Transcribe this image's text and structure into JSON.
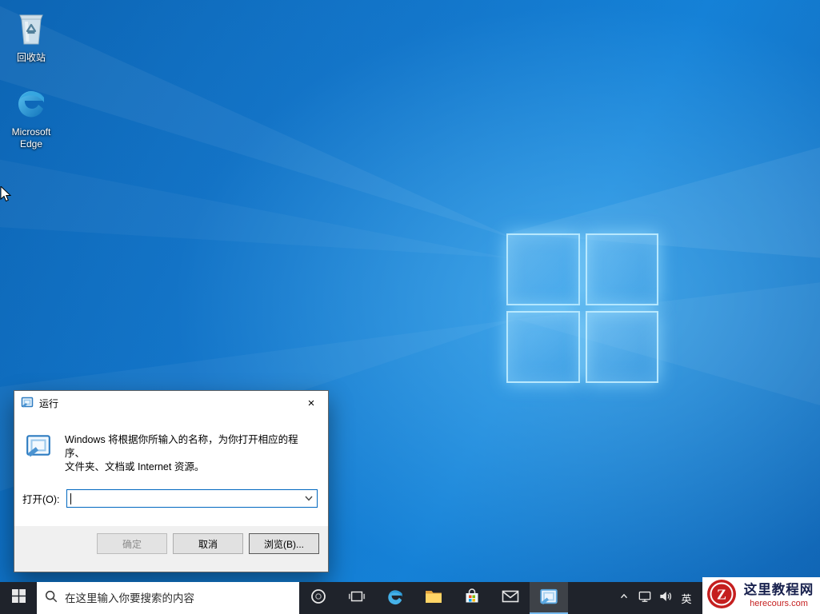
{
  "desktop": {
    "recycle_bin_label": "回收站",
    "edge_label": "Microsoft Edge"
  },
  "run_dialog": {
    "title": "运行",
    "close_label": "×",
    "description_line1": "Windows 将根据你所输入的名称，为你打开相应的程序、",
    "description_line2": "文件夹、文档或 Internet 资源。",
    "open_label": "打开(O):",
    "input_value": "",
    "ok_label": "确定",
    "cancel_label": "取消",
    "browse_label": "浏览(B)..."
  },
  "taskbar": {
    "search_placeholder": "在这里输入你要搜索的内容",
    "ime_indicator": "英"
  },
  "watermark": {
    "site_name": "这里教程网",
    "site_domain": "herecours.com",
    "logo_letter": "Z"
  },
  "colors": {
    "accent_blue": "#0078d7",
    "taskbar_bg": "#1f232b",
    "wallpaper_blue": "#0f74cb",
    "watermark_red": "#c51f1f"
  }
}
